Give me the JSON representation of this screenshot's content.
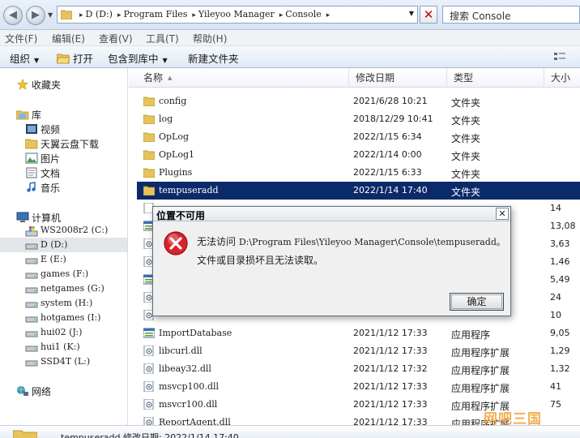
{
  "address": {
    "path": [
      "D (D:)",
      "Program Files",
      "Yileyoo Manager",
      "Console"
    ],
    "search_placeholder": "搜索 Console"
  },
  "menu": [
    "文件(F)",
    "编辑(E)",
    "查看(V)",
    "工具(T)",
    "帮助(H)"
  ],
  "toolbar": {
    "organize": "组织",
    "open": "打开",
    "include": "包含到库中",
    "new_folder": "新建文件夹"
  },
  "nav": {
    "favorites": "收藏夹",
    "libraries": "库",
    "lib_items": [
      "视频",
      "天翼云盘下载",
      "图片",
      "文档",
      "音乐"
    ],
    "computer": "计算机",
    "drives": [
      "WS2008r2 (C:)",
      "D (D:)",
      "E (E:)",
      "games (F:)",
      "netgames (G:)",
      "system (H:)",
      "hotgames (I:)",
      "hui02 (J:)",
      "hui1 (K:)",
      "SSD4T (L:)"
    ],
    "network": "网络"
  },
  "columns": [
    "名称",
    "修改日期",
    "类型",
    "大小"
  ],
  "files": [
    {
      "name": "config",
      "date": "2021/6/28 10:21",
      "type": "文件夹",
      "size": "",
      "icon": "folder-icon"
    },
    {
      "name": "log",
      "date": "2018/12/29 10:41",
      "type": "文件夹",
      "size": "",
      "icon": "folder-icon"
    },
    {
      "name": "OpLog",
      "date": "2022/1/15 6:34",
      "type": "文件夹",
      "size": "",
      "icon": "folder-icon"
    },
    {
      "name": "OpLog1",
      "date": "2022/1/14 0:00",
      "type": "文件夹",
      "size": "",
      "icon": "folder-icon"
    },
    {
      "name": "Plugins",
      "date": "2022/1/15 6:33",
      "type": "文件夹",
      "size": "",
      "icon": "folder-icon"
    },
    {
      "name": "tempuseradd",
      "date": "2022/1/14 17:40",
      "type": "文件夹",
      "size": "",
      "icon": "folder-icon",
      "selected": true
    },
    {
      "name": "",
      "date": "",
      "type": "",
      "size": "14",
      "icon": "file-icon"
    },
    {
      "name": "",
      "date": "",
      "type": "",
      "size": "13,08",
      "icon": "app-icon"
    },
    {
      "name": "",
      "date": "",
      "type": "",
      "size": "3,63",
      "icon": "dll-icon"
    },
    {
      "name": "",
      "date": "",
      "type": "",
      "size": "1,46",
      "icon": "dll-icon"
    },
    {
      "name": "",
      "date": "",
      "type": "",
      "size": "5,49",
      "icon": "app-icon"
    },
    {
      "name": "",
      "date": "",
      "type": "",
      "size": "24",
      "icon": "dll-icon"
    },
    {
      "name": "",
      "date": "",
      "type": "",
      "size": "10",
      "icon": "dll-icon"
    },
    {
      "name": "ImportDatabase",
      "date": "2021/1/12 17:33",
      "type": "应用程序",
      "size": "9,05",
      "icon": "app-icon"
    },
    {
      "name": "libcurl.dll",
      "date": "2021/1/12 17:33",
      "type": "应用程序扩展",
      "size": "1,29",
      "icon": "dll-icon"
    },
    {
      "name": "libeay32.dll",
      "date": "2021/1/12 17:32",
      "type": "应用程序扩展",
      "size": "1,32",
      "icon": "dll-icon"
    },
    {
      "name": "msvcp100.dll",
      "date": "2021/1/12 17:33",
      "type": "应用程序扩展",
      "size": "41",
      "icon": "dll-icon"
    },
    {
      "name": "msvcr100.dll",
      "date": "2021/1/12 17:33",
      "type": "应用程序扩展",
      "size": "75",
      "icon": "dll-icon"
    },
    {
      "name": "ReportAgent.dll",
      "date": "2021/1/12 17:33",
      "type": "应用程序扩展",
      "size": "",
      "icon": "dll-icon"
    }
  ],
  "status": {
    "text": "tempuseradd 修改日期: 2022/1/14 17:40"
  },
  "dialog": {
    "title": "位置不可用",
    "msg_prefix": "无法访问 ",
    "msg_path": "D:\\Program Files\\Yileyoo Manager\\Console\\tempuseradd。",
    "msg2": "文件或目录损坏且无法读取。",
    "ok": "确定",
    "close": "✕"
  },
  "watermark": "网吧三国"
}
